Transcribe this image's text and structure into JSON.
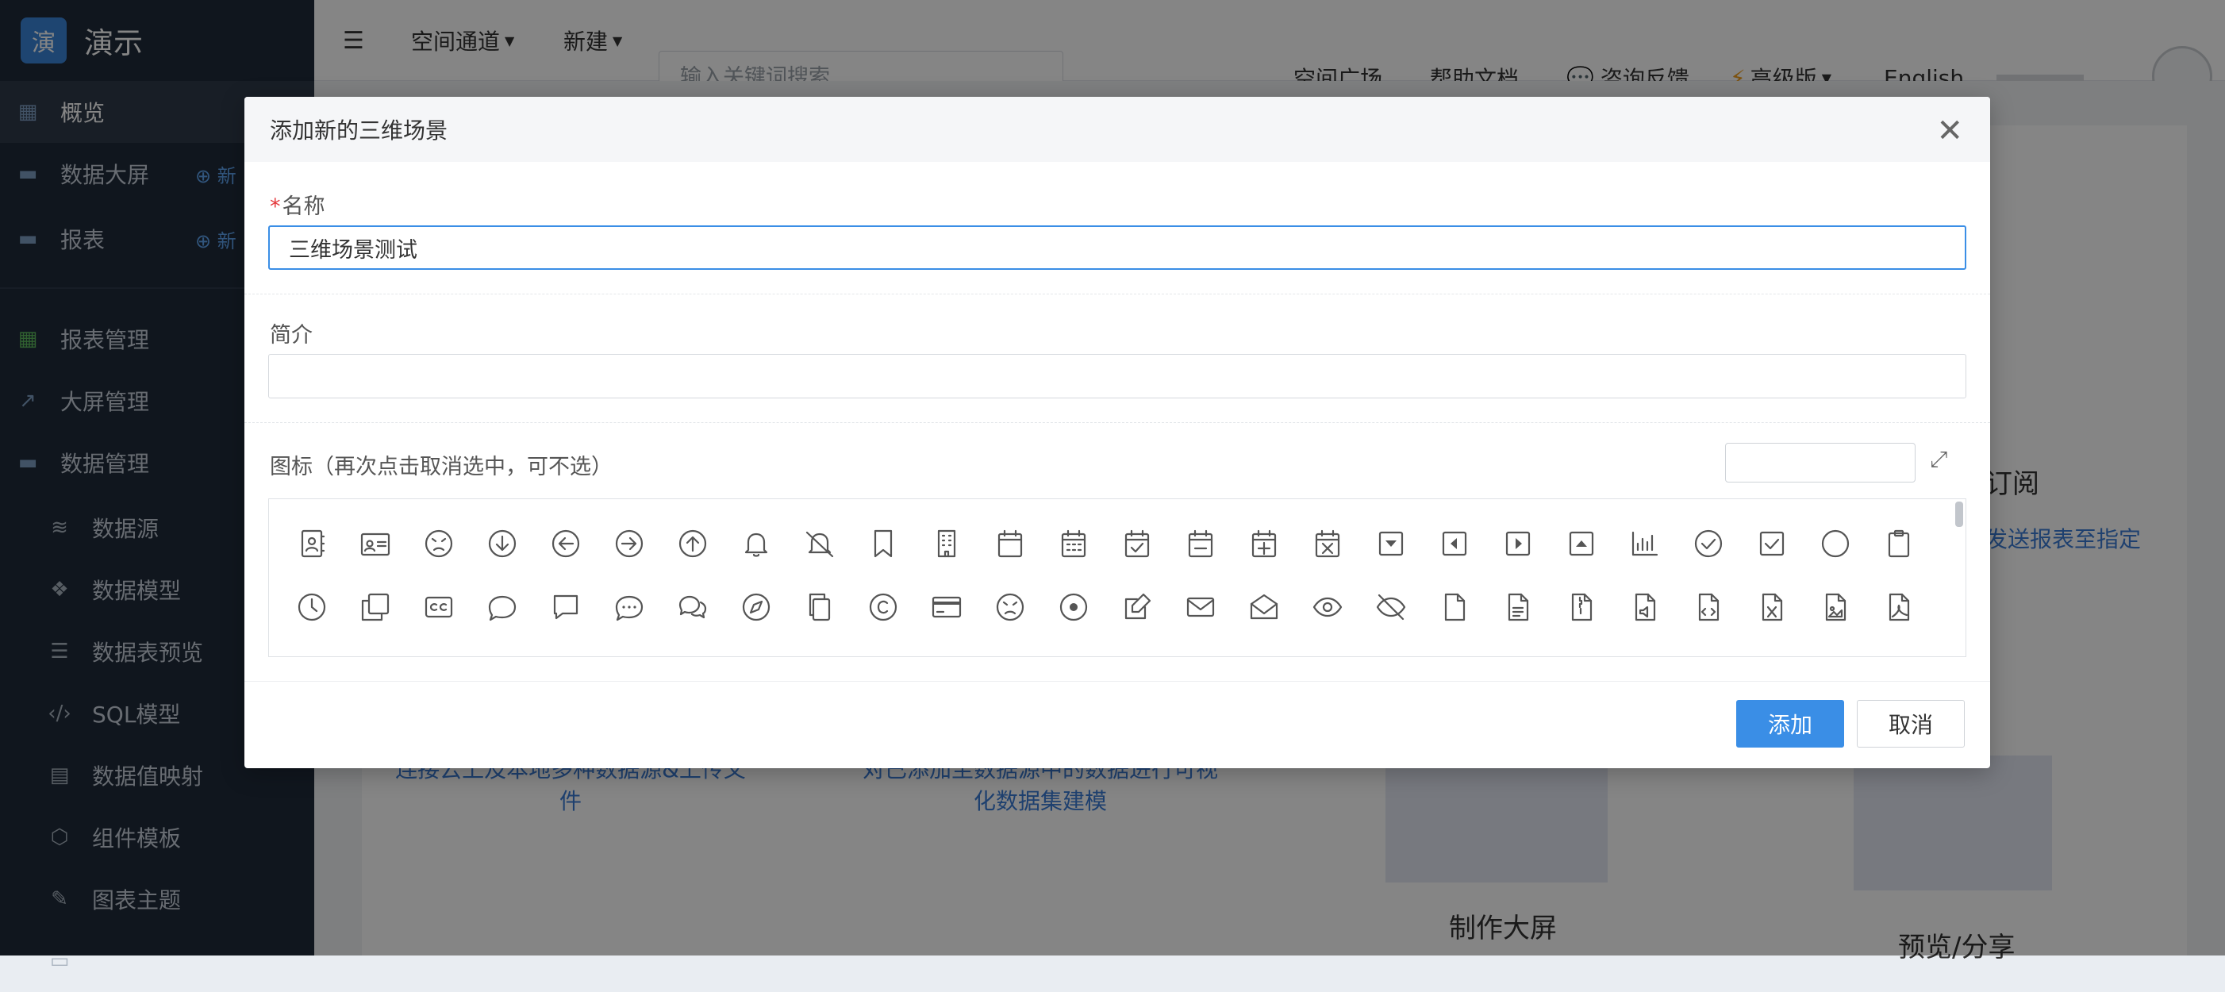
{
  "app": {
    "logo_char": "演",
    "name": "演示"
  },
  "sidebar": {
    "items": [
      {
        "label": "概览",
        "icon": "grid-icon"
      },
      {
        "label": "数据大屏",
        "icon": "folder-icon",
        "new": "⊕ 新"
      },
      {
        "label": "报表",
        "icon": "folder-icon",
        "new": "⊕ 新"
      },
      {
        "label": "报表管理",
        "icon": "table-icon"
      },
      {
        "label": "大屏管理",
        "icon": "chart-line-icon"
      },
      {
        "label": "数据管理",
        "icon": "folder-icon"
      },
      {
        "label": "数据源",
        "icon": "database-icon"
      },
      {
        "label": "数据模型",
        "icon": "cubes-icon"
      },
      {
        "label": "数据表预览",
        "icon": "list-icon"
      },
      {
        "label": "SQL模型",
        "icon": "code-icon"
      },
      {
        "label": "数据值映射",
        "icon": "book-icon"
      },
      {
        "label": "组件模板",
        "icon": "cube-icon"
      },
      {
        "label": "图表主题",
        "icon": "magic-wand-icon"
      },
      {
        "label": "",
        "icon": "generic-icon"
      }
    ]
  },
  "header": {
    "nav": [
      {
        "label": "空间通道"
      },
      {
        "label": "新建"
      }
    ],
    "search_placeholder": "输入关键词搜索",
    "right": {
      "plaza": "空间广场",
      "help": "帮助文档",
      "feedback": "咨询反馈",
      "edition": "高级版",
      "language": "English"
    }
  },
  "background": {
    "step_texts": [
      "连接云上及本地多种数据源&上传文件",
      "对已添加至数据源中的数据进行可视化数据集建模",
      "发送报表至指定"
    ],
    "titles": [
      "订阅",
      "制作大屏",
      "预览/分享"
    ]
  },
  "modal": {
    "title": "添加新的三维场景",
    "name_label": "名称",
    "name_value": "三维场景测试",
    "desc_label": "简介",
    "desc_value": "",
    "icon_label": "图标（再次点击取消选中，可不选）",
    "icon_search_value": "",
    "add_button": "添加",
    "cancel_button": "取消",
    "icons_row1": [
      "address-book-icon",
      "id-card-icon",
      "angry-face-icon",
      "arrow-circle-down-icon",
      "arrow-circle-left-icon",
      "arrow-circle-right-icon",
      "arrow-circle-up-icon",
      "bell-icon",
      "bell-slash-icon",
      "bookmark-icon",
      "building-icon",
      "calendar-icon",
      "calendar-grid-icon",
      "calendar-check-icon",
      "calendar-minus-icon",
      "calendar-plus-icon",
      "calendar-times-icon",
      "caret-square-down-icon",
      "caret-square-left-icon",
      "caret-square-right-icon",
      "caret-square-up-icon",
      "chart-bar-icon",
      "check-circle-icon",
      "check-square-icon",
      "circle-icon",
      "clipboard-icon"
    ],
    "icons_row2": [
      "clock-icon",
      "clone-icon",
      "closed-captioning-icon",
      "comment-icon",
      "comment-alt-icon",
      "comment-dots-icon",
      "comments-icon",
      "compass-icon",
      "copy-icon",
      "copyright-icon",
      "credit-card-icon",
      "dizzy-face-icon",
      "dot-circle-icon",
      "edit-icon",
      "envelope-icon",
      "envelope-open-icon",
      "eye-icon",
      "eye-slash-icon",
      "file-icon",
      "file-alt-icon",
      "file-archive-icon",
      "file-audio-icon",
      "file-code-icon",
      "file-excel-icon",
      "file-image-icon",
      "file-pdf-icon"
    ]
  }
}
